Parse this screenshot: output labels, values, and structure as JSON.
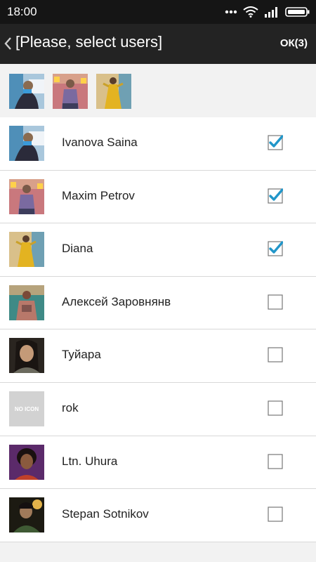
{
  "status_bar": {
    "time": "18:00"
  },
  "app_bar": {
    "title": "[Please, select users]",
    "ok_label": "ОК(3)"
  },
  "selected_users": [
    "Ivanova Saina",
    "Maxim Petrov",
    "Diana"
  ],
  "users": [
    {
      "name": "Ivanova Saina",
      "checked": true
    },
    {
      "name": "Maxim Petrov",
      "checked": true
    },
    {
      "name": "Diana",
      "checked": true
    },
    {
      "name": "Алексей Заровнянв",
      "checked": false
    },
    {
      "name": "Туйара",
      "checked": false
    },
    {
      "name": "rok",
      "checked": false,
      "avatar_text": "NO ICON"
    },
    {
      "name": "Ltn. Uhura",
      "checked": false
    },
    {
      "name": "Stepan Sotnikov",
      "checked": false
    }
  ],
  "colors": {
    "accent": "#2196c9",
    "appbar": "#232323",
    "statusbar": "#151515"
  }
}
